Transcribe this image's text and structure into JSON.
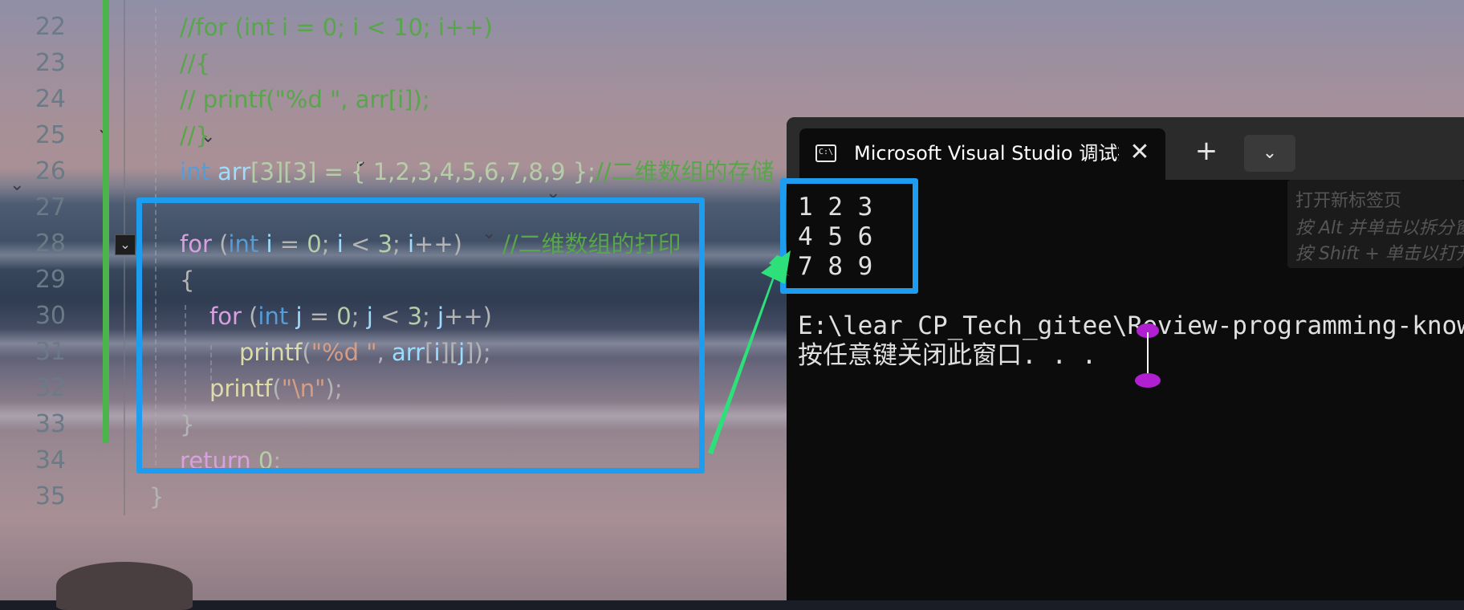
{
  "editor": {
    "line_numbers": [
      "22",
      "23",
      "24",
      "25",
      "26",
      "27",
      "28",
      "29",
      "30",
      "31",
      "32",
      "33",
      "34",
      "35"
    ],
    "line22": "//for (int i = 0; i < 10; i++)",
    "line23": "//{",
    "line24": "// printf(\"%d \", arr[i]);",
    "line25": "//}",
    "line26": {
      "kw_int": "int",
      "arr": "arr",
      "decl_rest": "[3][3] = { 1,2,3,4,5,6,7,8,9 };",
      "comment": "//二维数组的存储"
    },
    "line28": {
      "for": "for",
      "open": " (",
      "int": "int",
      "i": " i",
      "rest1": " = ",
      "zero": "0",
      "semi1": "; ",
      "i2": "i",
      "lt": " < ",
      "three": "3",
      "semi2": "; ",
      "i3": "i",
      "inc": "++)",
      "comment": "//二维数组的打印"
    },
    "line29": "{",
    "line30": {
      "for": "for",
      "open": " (",
      "int": "int",
      "j": " j",
      "rest1": " = ",
      "zero": "0",
      "semi1": "; ",
      "j2": "j",
      "lt": " < ",
      "three": "3",
      "semi2": "; ",
      "j3": "j",
      "inc": "++)"
    },
    "line31": {
      "fn": "printf",
      "open": "(",
      "str": "\"%d \"",
      "comma": ", ",
      "arr": "arr",
      "idx_open": "[",
      "i": "i",
      "idx_mid": "][",
      "j": "j",
      "idx_close": "]);"
    },
    "line32": {
      "fn": "printf",
      "open": "(",
      "str": "\"\\n\"",
      "close": ");"
    },
    "line33": "}",
    "line34": {
      "ret": "return",
      "zero": " 0",
      "semi": ";"
    },
    "line35": "}",
    "fold_glyph": "⌄"
  },
  "terminal": {
    "tab_title": "Microsoft Visual Studio 调试控制台",
    "tab_icon_text": "C:\\",
    "close_glyph": "✕",
    "new_tab_glyph": "+",
    "dropdown_glyph": "⌄",
    "tooltip": {
      "line1": "打开新标签页",
      "line2": "按 Alt 并单击以拆分窗口",
      "line3": "按 Shift + 单击以打开新窗口"
    },
    "output_rows": [
      "1 2 3",
      "4 5 6",
      "7 8 9"
    ],
    "path_line": "E:\\lear_CP_Tech_gitee\\Review-programming-knowledge",
    "prompt_line": "按任意键关闭此窗口. . ."
  },
  "colors": {
    "highlight_box": "#1e9cf0",
    "arrow": "#2ee07a",
    "git_change_bar": "#4bb54b"
  }
}
